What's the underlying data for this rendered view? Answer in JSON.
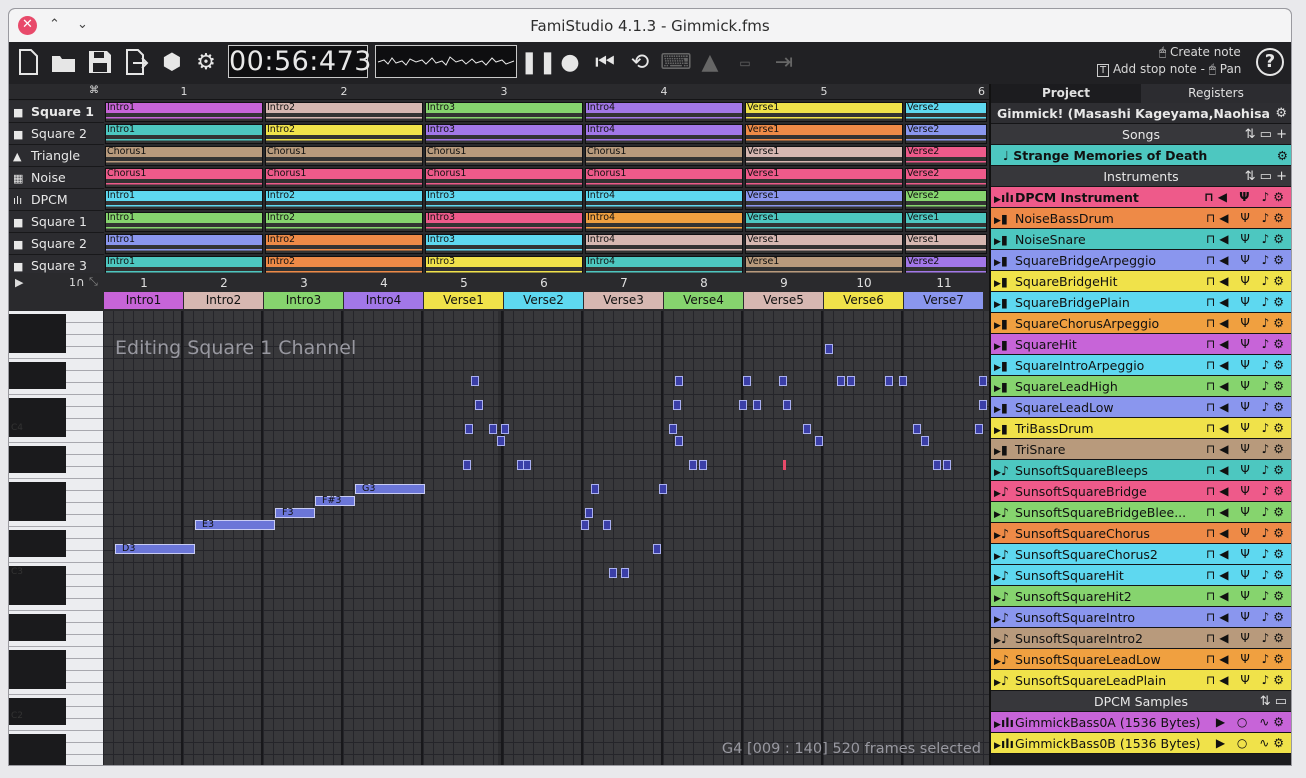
{
  "window": {
    "title": "FamiStudio 4.1.3 - Gimmick.fms"
  },
  "toolbar": {
    "timer": "00:56:473",
    "tip_create_note": "Create note",
    "tip_add_stop_note": "Add stop note -",
    "tip_pan": "Pan"
  },
  "sequencer": {
    "bar_numbers": [
      "1",
      "2",
      "3",
      "4",
      "5",
      "6"
    ],
    "channels": [
      {
        "name": "Square 1",
        "bold": true,
        "icon": "square-icon"
      },
      {
        "name": "Square 2",
        "icon": "square-icon"
      },
      {
        "name": "Triangle",
        "icon": "triangle-icon"
      },
      {
        "name": "Noise",
        "icon": "noise-icon"
      },
      {
        "name": "DPCM",
        "icon": "dpcm-icon"
      },
      {
        "name": "Square 1",
        "icon": "square-icon"
      },
      {
        "name": "Square 2",
        "icon": "square-icon"
      },
      {
        "name": "Square 3",
        "icon": "square-icon"
      }
    ],
    "rows": [
      {
        "patterns": [
          {
            "name": "Intro1",
            "color": "#c764d8"
          },
          {
            "name": "Intro2",
            "color": "#d6b7b1"
          },
          {
            "name": "Intro3",
            "color": "#86d46e"
          },
          {
            "name": "Intro4",
            "color": "#a277e8"
          },
          {
            "name": "Verse1",
            "color": "#f0e24a"
          },
          {
            "name": "Verse2",
            "color": "#5ed8f0"
          }
        ]
      },
      {
        "patterns": [
          {
            "name": "Intro1",
            "color": "#4dc7c0"
          },
          {
            "name": "Intro2",
            "color": "#f0e24a"
          },
          {
            "name": "Intro3",
            "color": "#a277e8"
          },
          {
            "name": "Intro4",
            "color": "#a277e8"
          },
          {
            "name": "Verse1",
            "color": "#ee8a47"
          },
          {
            "name": "Verse2",
            "color": "#8a96ee"
          }
        ]
      },
      {
        "patterns": [
          {
            "name": "Chorus1",
            "color": "#b89a7c"
          },
          {
            "name": "Chorus1",
            "color": "#b89a7c"
          },
          {
            "name": "Chorus1",
            "color": "#b89a7c"
          },
          {
            "name": "Chorus1",
            "color": "#b89a7c"
          },
          {
            "name": "Verse1",
            "color": "#d6b7b1"
          },
          {
            "name": "Verse2",
            "color": "#ee5a8a"
          }
        ]
      },
      {
        "patterns": [
          {
            "name": "Chorus1",
            "color": "#ee5a8a"
          },
          {
            "name": "Chorus1",
            "color": "#ee5a8a"
          },
          {
            "name": "Chorus1",
            "color": "#ee5a8a"
          },
          {
            "name": "Chorus1",
            "color": "#ee5a8a"
          },
          {
            "name": "Verse1",
            "color": "#ee5a8a"
          },
          {
            "name": "Verse2",
            "color": "#ee5a8a"
          }
        ]
      },
      {
        "patterns": [
          {
            "name": "Intro1",
            "color": "#5ed8f0"
          },
          {
            "name": "Intro2",
            "color": "#5ed8f0"
          },
          {
            "name": "Intro3",
            "color": "#5ed8f0"
          },
          {
            "name": "Intro4",
            "color": "#5ed8f0"
          },
          {
            "name": "Verse1",
            "color": "#8a96ee"
          },
          {
            "name": "Verse2",
            "color": "#86d46e"
          }
        ]
      },
      {
        "patterns": [
          {
            "name": "Intro1",
            "color": "#86d46e"
          },
          {
            "name": "Intro2",
            "color": "#86d46e"
          },
          {
            "name": "Intro3",
            "color": "#ee5a8a"
          },
          {
            "name": "Intro4",
            "color": "#f0a040"
          },
          {
            "name": "Verse1",
            "color": "#4dc7c0"
          },
          {
            "name": "Verse1",
            "color": "#4dc7c0"
          }
        ]
      },
      {
        "patterns": [
          {
            "name": "Intro1",
            "color": "#8a96ee"
          },
          {
            "name": "Intro2",
            "color": "#ee8a47"
          },
          {
            "name": "Intro3",
            "color": "#5ed8f0"
          },
          {
            "name": "Intro4",
            "color": "#d6b7b1"
          },
          {
            "name": "Verse1",
            "color": "#d6b7b1"
          },
          {
            "name": "Verse1",
            "color": "#d6b7b1"
          }
        ]
      },
      {
        "patterns": [
          {
            "name": "Intro1",
            "color": "#4dc7c0"
          },
          {
            "name": "Intro2",
            "color": "#ee8a47"
          },
          {
            "name": "Intro3",
            "color": "#f0e24a"
          },
          {
            "name": "Intro4",
            "color": "#4dc7c0"
          },
          {
            "name": "Verse1",
            "color": "#b89a7c"
          },
          {
            "name": "Verse2",
            "color": "#a277e8"
          }
        ]
      }
    ]
  },
  "pianoroll": {
    "header_left": "1",
    "bar_numbers": [
      "1",
      "2",
      "3",
      "4",
      "5",
      "6",
      "7",
      "8",
      "9",
      "10",
      "11"
    ],
    "segments": [
      {
        "name": "Intro1",
        "color": "#c764d8"
      },
      {
        "name": "Intro2",
        "color": "#d6b7b1"
      },
      {
        "name": "Intro3",
        "color": "#86d46e"
      },
      {
        "name": "Intro4",
        "color": "#a277e8"
      },
      {
        "name": "Verse1",
        "color": "#f0e24a"
      },
      {
        "name": "Verse2",
        "color": "#5ed8f0"
      },
      {
        "name": "Verse3",
        "color": "#d6b7b1"
      },
      {
        "name": "Verse4",
        "color": "#86d46e"
      },
      {
        "name": "Verse5",
        "color": "#d6b7b1"
      },
      {
        "name": "Verse6",
        "color": "#f0e24a"
      },
      {
        "name": "Verse7",
        "color": "#8a96ee"
      }
    ],
    "octave_labels": [
      "C4",
      "C3",
      "C2"
    ],
    "note_labels": [
      "D3",
      "E3",
      "F3",
      "F#3",
      "G3"
    ],
    "editing_message": "Editing Square 1 Channel",
    "status": "G4 [009 : 140] 520 frames selected"
  },
  "project_panel": {
    "tabs": [
      "Project",
      "Registers"
    ],
    "project_title": "Gimmick! (Masashi Kageyama,Naohisa Morot...",
    "songs_header": "Songs",
    "songs": [
      {
        "name": "Strange Memories of Death",
        "color": "#4dc7c0"
      }
    ],
    "instruments_header": "Instruments",
    "instruments": [
      {
        "name": "DPCM Instrument",
        "color": "#ee5a8a",
        "bold": true,
        "icon": "dpcm-instrument-icon"
      },
      {
        "name": "NoiseBassDrum",
        "color": "#ee8a47",
        "icon": "instrument-icon"
      },
      {
        "name": "NoiseSnare",
        "color": "#4dc7c0",
        "icon": "instrument-icon"
      },
      {
        "name": "SquareBridgeArpeggio",
        "color": "#8a96ee",
        "icon": "instrument-icon"
      },
      {
        "name": "SquareBridgeHit",
        "color": "#f0e24a",
        "icon": "instrument-icon"
      },
      {
        "name": "SquareBridgePlain",
        "color": "#5ed8f0",
        "icon": "instrument-icon"
      },
      {
        "name": "SquareChorusArpeggio",
        "color": "#f0a040",
        "icon": "instrument-icon"
      },
      {
        "name": "SquareHit",
        "color": "#c764d8",
        "icon": "instrument-icon"
      },
      {
        "name": "SquareIntroArpeggio",
        "color": "#5ed8f0",
        "icon": "instrument-icon"
      },
      {
        "name": "SquareLeadHigh",
        "color": "#86d46e",
        "icon": "instrument-icon"
      },
      {
        "name": "SquareLeadLow",
        "color": "#8a96ee",
        "icon": "instrument-icon"
      },
      {
        "name": "TriBassDrum",
        "color": "#f0e24a",
        "icon": "instrument-icon"
      },
      {
        "name": "TriSnare",
        "color": "#b89a7c",
        "icon": "instrument-icon"
      },
      {
        "name": "SunsoftSquareBleeps",
        "color": "#4dc7c0",
        "icon": "sunsoft-icon"
      },
      {
        "name": "SunsoftSquareBridge",
        "color": "#ee5a8a",
        "icon": "sunsoft-icon"
      },
      {
        "name": "SunsoftSquareBridgeBlee...",
        "color": "#86d46e",
        "icon": "sunsoft-icon"
      },
      {
        "name": "SunsoftSquareChorus",
        "color": "#ee8a47",
        "icon": "sunsoft-icon"
      },
      {
        "name": "SunsoftSquareChorus2",
        "color": "#5ed8f0",
        "icon": "sunsoft-icon"
      },
      {
        "name": "SunsoftSquareHit",
        "color": "#5ed8f0",
        "icon": "sunsoft-icon"
      },
      {
        "name": "SunsoftSquareHit2",
        "color": "#86d46e",
        "icon": "sunsoft-icon"
      },
      {
        "name": "SunsoftSquareIntro",
        "color": "#8a96ee",
        "icon": "sunsoft-icon"
      },
      {
        "name": "SunsoftSquareIntro2",
        "color": "#b89a7c",
        "icon": "sunsoft-icon"
      },
      {
        "name": "SunsoftSquareLeadLow",
        "color": "#f0a040",
        "icon": "sunsoft-icon"
      },
      {
        "name": "SunsoftSquareLeadPlain",
        "color": "#f0e24a",
        "icon": "sunsoft-icon"
      }
    ],
    "dpcm_header": "DPCM Samples",
    "samples": [
      {
        "name": "GimmickBass0A (1536 Bytes)",
        "color": "#c764d8"
      },
      {
        "name": "GimmickBass0B (1536 Bytes)",
        "color": "#f0e24a"
      }
    ]
  }
}
